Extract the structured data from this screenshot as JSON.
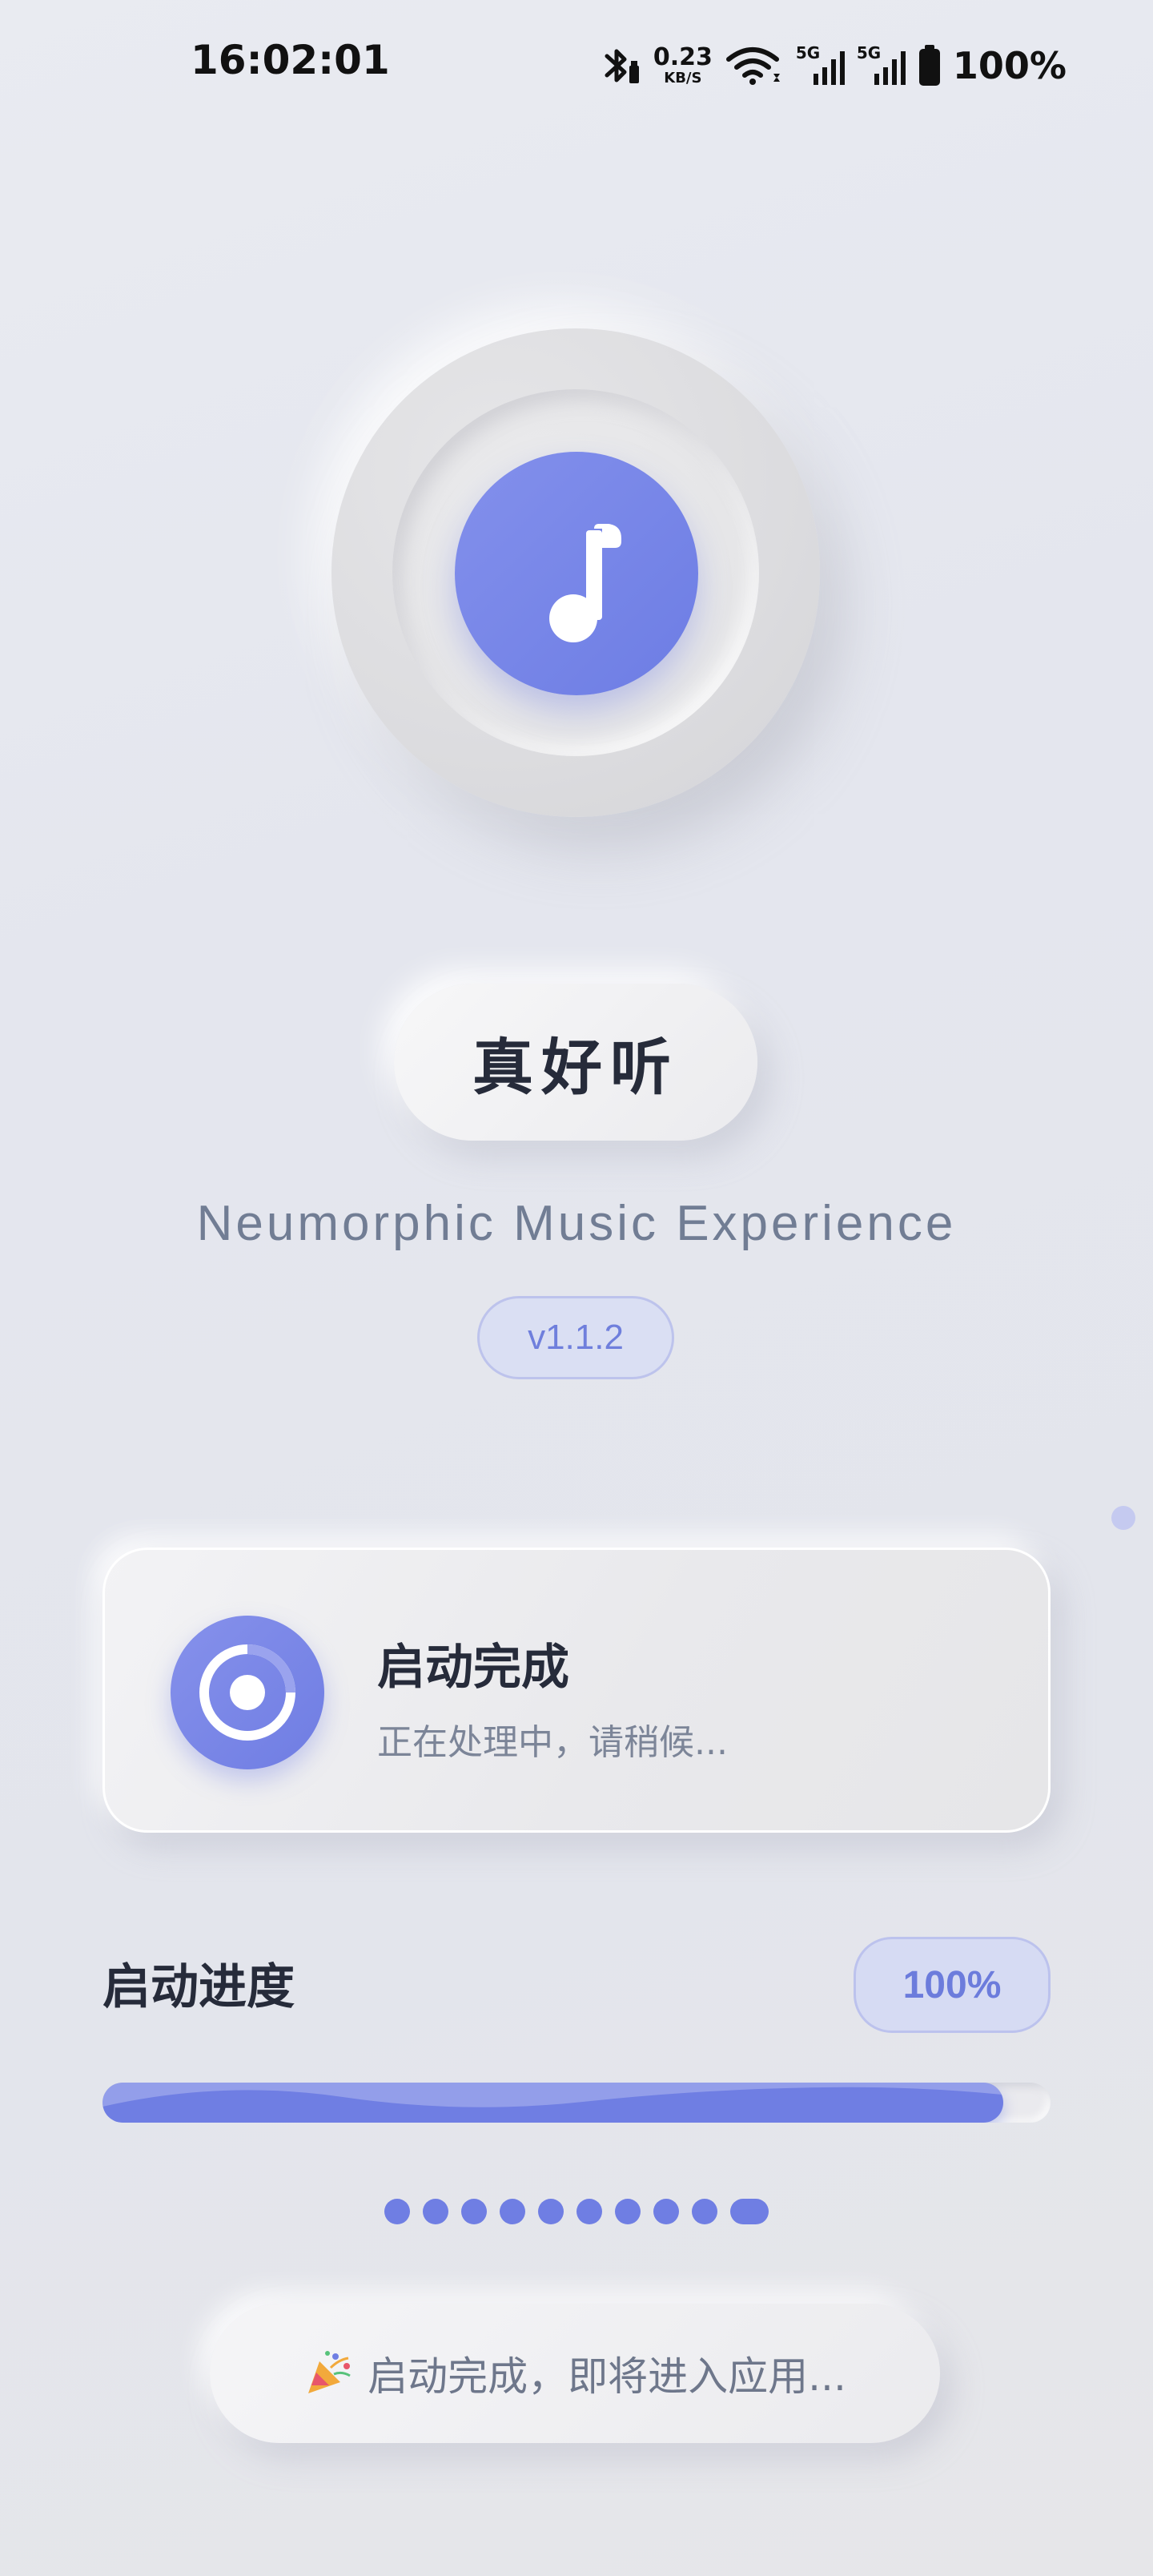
{
  "status_bar": {
    "time": "16:02:01",
    "net_speed_value": "0.23",
    "net_speed_unit": "KB/S",
    "signal1_tag": "5G",
    "signal2_tag": "5G",
    "battery": "100%",
    "icons": [
      "bluetooth-icon",
      "wifi-icon",
      "signal-icon",
      "battery-icon"
    ]
  },
  "app": {
    "title": "真好听",
    "subtitle": "Neumorphic Music Experience",
    "version": "v1.1.2",
    "accent_color": "#6f7ee3"
  },
  "status_card": {
    "title": "启动完成",
    "subtitle": "正在处理中，请稍候..."
  },
  "progress": {
    "label": "启动进度",
    "percent_text": "100%",
    "value": 0.95
  },
  "pager": {
    "count": 10,
    "active_index": 9
  },
  "toast": {
    "icon": "party-popper-icon",
    "text": "启动完成，即将进入应用..."
  }
}
